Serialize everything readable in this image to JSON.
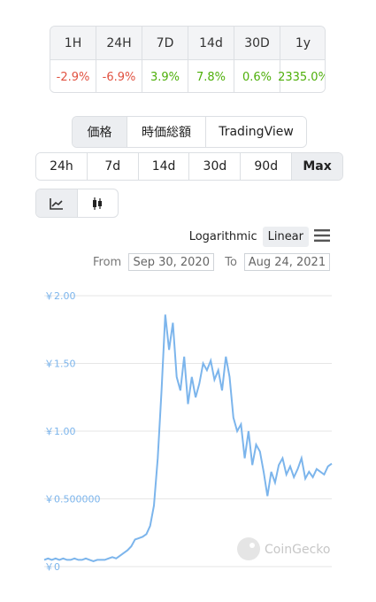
{
  "performance": {
    "headers": [
      "1H",
      "24H",
      "7D",
      "14d",
      "30D",
      "1y"
    ],
    "values": [
      "-2.9%",
      "-6.9%",
      "3.9%",
      "7.8%",
      "0.6%",
      "2335.0%"
    ],
    "signs": [
      "neg",
      "neg",
      "pos",
      "pos",
      "pos",
      "pos"
    ]
  },
  "chart_tabs": [
    "価格",
    "時価総額",
    "TradingView"
  ],
  "range_tabs": [
    "24h",
    "7d",
    "14d",
    "30d",
    "90d",
    "Max"
  ],
  "active_range": "Max",
  "scale": {
    "log_label": "Logarithmic",
    "linear_label": "Linear",
    "active": "Linear"
  },
  "date_range": {
    "from_label": "From",
    "from_value": "Sep 30, 2020",
    "to_label": "To",
    "to_value": "Aug 24, 2021"
  },
  "watermark": "CoinGecko",
  "colors": {
    "line": "#7cb5ec",
    "negative": "#e15241",
    "positive": "#4eaf0a",
    "active_bg": "#eceef1"
  },
  "chart_data": {
    "type": "line",
    "y_tick_labels": [
      "￥2.00",
      "￥1.50",
      "￥1.00",
      "￥0.500000",
      "￥0"
    ],
    "ylim": [
      0,
      2.0
    ],
    "grid": true,
    "series": [
      {
        "values": [
          0.05,
          0.06,
          0.05,
          0.06,
          0.05,
          0.06,
          0.05,
          0.05,
          0.06,
          0.05,
          0.05,
          0.06,
          0.05,
          0.04,
          0.05,
          0.05,
          0.05,
          0.06,
          0.07,
          0.06,
          0.08,
          0.1,
          0.12,
          0.15,
          0.2,
          0.21,
          0.22,
          0.24,
          0.3,
          0.45,
          0.8,
          1.3,
          1.86,
          1.6,
          1.8,
          1.4,
          1.3,
          1.55,
          1.2,
          1.4,
          1.25,
          1.35,
          1.5,
          1.45,
          1.52,
          1.38,
          1.45,
          1.3,
          1.55,
          1.4,
          1.1,
          1.0,
          1.05,
          0.8,
          1.0,
          0.75,
          0.9,
          0.85,
          0.7,
          0.52,
          0.7,
          0.62,
          0.75,
          0.8,
          0.68,
          0.74,
          0.66,
          0.72,
          0.8,
          0.65,
          0.7,
          0.66,
          0.72,
          0.7,
          0.68,
          0.74,
          0.76
        ]
      }
    ]
  }
}
